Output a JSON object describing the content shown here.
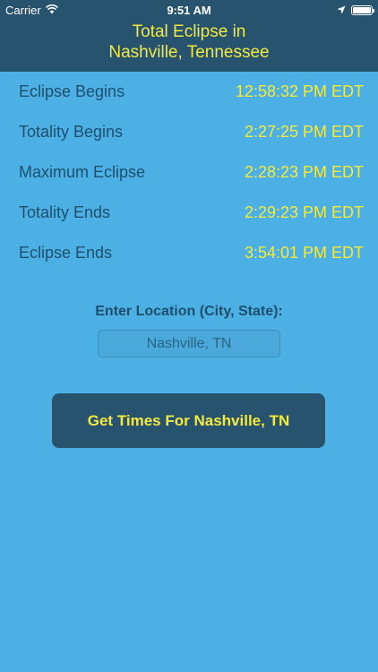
{
  "status_bar": {
    "carrier": "Carrier",
    "time": "9:51 AM",
    "battery_level": 1.0,
    "icons": [
      "wifi-icon",
      "location-arrow-icon",
      "battery-icon"
    ]
  },
  "header": {
    "title_line1": "Total Eclipse in",
    "title_line2": "Nashville, Tennessee"
  },
  "eclipse_times": [
    {
      "label": "Eclipse Begins",
      "value": "12:58:32 PM EDT"
    },
    {
      "label": "Totality Begins",
      "value": "2:27:25 PM EDT"
    },
    {
      "label": "Maximum Eclipse",
      "value": "2:28:23 PM EDT"
    },
    {
      "label": "Totality Ends",
      "value": "2:29:23 PM EDT"
    },
    {
      "label": "Eclipse Ends",
      "value": "3:54:01 PM EDT"
    }
  ],
  "location": {
    "label": "Enter Location (City, State):",
    "value": "",
    "placeholder": "Nashville, TN"
  },
  "button": {
    "label": "Get Times For Nashville, TN"
  },
  "colors": {
    "background": "#4db0e4",
    "header": "#27536f",
    "accent_yellow": "#f4ea3e",
    "label_blue": "#1d4f6d"
  }
}
